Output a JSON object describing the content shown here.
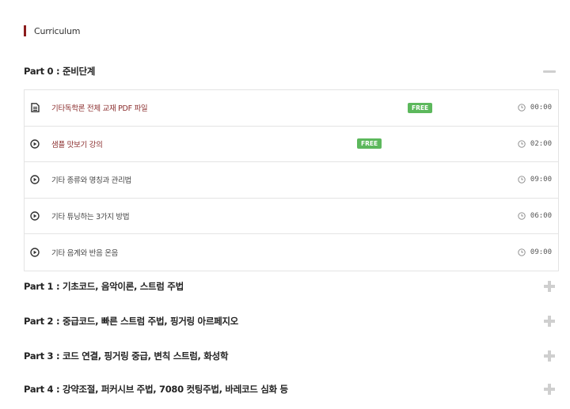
{
  "section": {
    "title": "Curriculum"
  },
  "parts": [
    {
      "title": "Part 0 : 준비단계",
      "expanded": true,
      "toggle_icon": "minus-icon"
    },
    {
      "title": "Part 1 : 기초코드, 음악이론, 스트럼 주법",
      "expanded": false,
      "toggle_icon": "plus-icon"
    },
    {
      "title": "Part 2 : 중급코드, 빠른 스트럼 주법, 핑거링 아르페지오",
      "expanded": false,
      "toggle_icon": "plus-icon"
    },
    {
      "title": "Part 3 : 코드 연결, 핑거링 중급, 변칙 스트럼, 화성학",
      "expanded": false,
      "toggle_icon": "plus-icon"
    },
    {
      "title": "Part 4 : 강약조절, 퍼커시브 주법, 7080 컷팅주법, 바레코드 심화 등",
      "expanded": false,
      "toggle_icon": "plus-icon"
    }
  ],
  "lessons": [
    {
      "icon": "document-icon",
      "title": "기타독학론 전체 교재 PDF 파일",
      "free": "FREE",
      "duration": "00:00"
    },
    {
      "icon": "play-circle-icon",
      "title": "샘플 맛보기 강의",
      "free": "FREE",
      "duration": "02:00"
    },
    {
      "icon": "play-circle-icon",
      "title": "기타 종류와 명칭과 관리법",
      "duration": "09:00"
    },
    {
      "icon": "play-circle-icon",
      "title": "기타 튜닝하는 3가지 방법",
      "duration": "06:00"
    },
    {
      "icon": "play-circle-icon",
      "title": "기타 음계와 반음 온음",
      "duration": "09:00"
    }
  ],
  "colors": {
    "accent": "#8b1c1c",
    "free_badge": "#5cb85c",
    "toggle": "#cfcfcf",
    "border": "#e4e4e4"
  }
}
